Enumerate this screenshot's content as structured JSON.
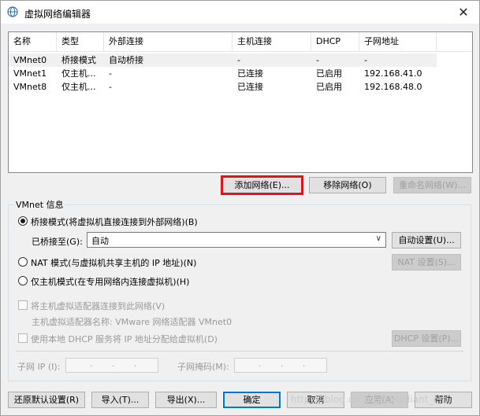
{
  "window": {
    "title": "虚拟网络编辑器",
    "icon": "network-globe-icon",
    "close_glyph": "✕"
  },
  "table": {
    "headers": [
      "名称",
      "类型",
      "外部连接",
      "主机连接",
      "DHCP",
      "子网地址"
    ],
    "rows": [
      [
        "VMnet0",
        "桥接模式",
        "自动桥接",
        "-",
        "-",
        "-"
      ],
      [
        "VMnet1",
        "仅主机...",
        "-",
        "已连接",
        "已启用",
        "192.168.41.0"
      ],
      [
        "VMnet8",
        "仅主机...",
        "-",
        "已连接",
        "已启用",
        "192.168.48.0"
      ]
    ],
    "selected_row": 0
  },
  "list_buttons": {
    "add": "添加网络(E)...",
    "remove": "移除网络(O)",
    "rename": "重命名网络(W)..."
  },
  "vmnet_info": {
    "group_label": "VMnet 信息",
    "bridged": {
      "label": "桥接模式(将虚拟机直接连接到外部网络)(B)",
      "selected": true
    },
    "bridged_to": {
      "label": "已桥接至(G):",
      "value": "自动",
      "auto_button": "自动设置(U)..."
    },
    "nat": {
      "label": "NAT 模式(与虚拟机共享主机的 IP 地址)(N)",
      "button": "NAT 设置(S)..."
    },
    "host_only": {
      "label": "仅主机模式(在专用网络内连接虚拟机)(H)"
    },
    "connect_adapter": {
      "label": "将主机虚拟适配器连接到此网络(V)",
      "adapter_name": "主机虚拟适配器名称: VMware 网络适配器 VMnet0"
    },
    "dhcp": {
      "label": "使用本地 DHCP 服务将 IP 地址分配给虚拟机(D)",
      "button": "DHCP 设置(P)..."
    },
    "subnet_ip": {
      "label": "子网 IP (I):",
      "dots": ".",
      "value": ".   .   ."
    },
    "subnet_mask": {
      "label": "子网掩码(M):",
      "value": ".   .   ."
    }
  },
  "footer_buttons": {
    "restore": "还原默认设置(R)",
    "import": "导入(T)...",
    "export": "导出(X)...",
    "ok": "确定",
    "cancel": "取消",
    "apply": "应用(A)",
    "help": "帮助"
  },
  "watermark": "https://blog.csdn.net/Radiant_era"
}
